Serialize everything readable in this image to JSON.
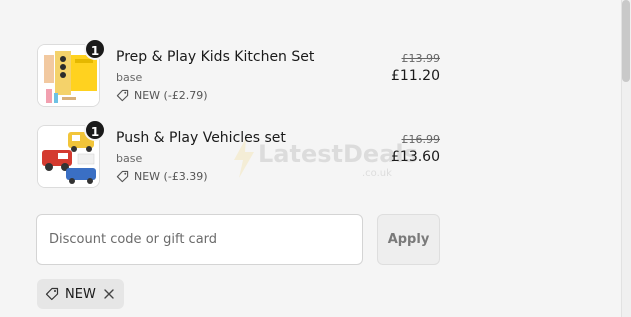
{
  "line_items": [
    {
      "title": "Prep & Play Kids Kitchen Set",
      "variant": "base",
      "quantity": "1",
      "discount_label": "NEW (-£2.79)",
      "compare_price": "£13.99",
      "price": "£11.20",
      "image_icon": "kitchen-set-image"
    },
    {
      "title": "Push & Play Vehicles set",
      "variant": "base",
      "quantity": "1",
      "discount_label": "NEW (-£3.39)",
      "compare_price": "£16.99",
      "price": "£13.60",
      "image_icon": "vehicles-set-image"
    }
  ],
  "watermark": {
    "text": "LatestDeals",
    "subtext": ".co.uk"
  },
  "discount_form": {
    "placeholder": "Discount code or gift card",
    "value": "",
    "apply_label": "Apply"
  },
  "applied_code": {
    "label": "NEW"
  },
  "colors": {
    "background": "#f5f5f5",
    "badge": "#1a1a1a",
    "chip": "#e6e6e6"
  }
}
